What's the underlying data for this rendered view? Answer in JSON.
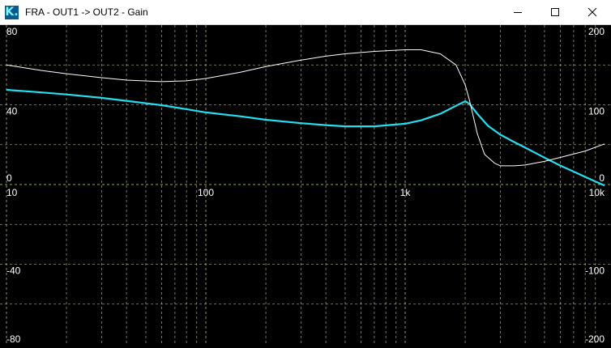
{
  "window": {
    "app_icon_glyph": "K.",
    "title": "FRA - OUT1 -> OUT2 - Gain",
    "controls": [
      "minimize-icon",
      "maximize-icon",
      "close-icon"
    ]
  },
  "chart_data": {
    "type": "line",
    "x_scale": "log",
    "xlim": [
      10,
      10000
    ],
    "x_tick_labels": [
      {
        "value": 10,
        "label": "10"
      },
      {
        "value": 100,
        "label": "100"
      },
      {
        "value": 1000,
        "label": "1k"
      },
      {
        "value": 10000,
        "label": "10k"
      }
    ],
    "y_left": {
      "lim": [
        -80,
        80
      ],
      "tick_labels": [
        "80",
        "40",
        "0",
        "-40",
        "-80"
      ],
      "tick_values": [
        80,
        40,
        0,
        -40,
        -80
      ]
    },
    "y_right": {
      "lim": [
        -200,
        200
      ],
      "tick_labels": [
        "200",
        "100",
        "0",
        "-100",
        "-200"
      ],
      "tick_values": [
        200,
        100,
        0,
        -100,
        -200
      ]
    },
    "grid": true,
    "colors": {
      "background": "#000000",
      "grid": "#d8d8a0",
      "zero_line": "#e0e060",
      "gain": "#22dff0",
      "phase": "#ffffff"
    },
    "series": [
      {
        "axis": "left",
        "color": "#22dff0",
        "x": [
          10,
          15,
          20,
          30,
          40,
          60,
          80,
          100,
          150,
          200,
          300,
          400,
          500,
          700,
          1000,
          1200,
          1500,
          1800,
          2000,
          2100,
          2300,
          2600,
          3000,
          3500,
          4000,
          5000,
          6000,
          7000,
          8000,
          10000
        ],
        "y": [
          47.5,
          46.2,
          45.2,
          43.5,
          42,
          39.8,
          37.8,
          36.2,
          34.2,
          32.5,
          30.8,
          29.8,
          29.2,
          29.2,
          30.5,
          32.2,
          35.5,
          39.5,
          41.8,
          40.5,
          35.5,
          29.5,
          25,
          21.5,
          18.5,
          13.5,
          9.5,
          6.5,
          3.8,
          -0.5
        ]
      },
      {
        "axis": "right",
        "color": "#ffffff",
        "x": [
          10,
          15,
          20,
          30,
          40,
          60,
          80,
          100,
          150,
          200,
          300,
          400,
          500,
          700,
          1000,
          1200,
          1500,
          1800,
          2000,
          2100,
          2300,
          2500,
          2800,
          3000,
          3500,
          4000,
          5000,
          6000,
          8000,
          10000
        ],
        "y": [
          150,
          143,
          139,
          134,
          131,
          129,
          130,
          133,
          141,
          148,
          156,
          161,
          164,
          167,
          169,
          169,
          164,
          150,
          125,
          106,
          64,
          38,
          27,
          23.5,
          23.5,
          24.5,
          29,
          34,
          42,
          51
        ]
      }
    ]
  }
}
